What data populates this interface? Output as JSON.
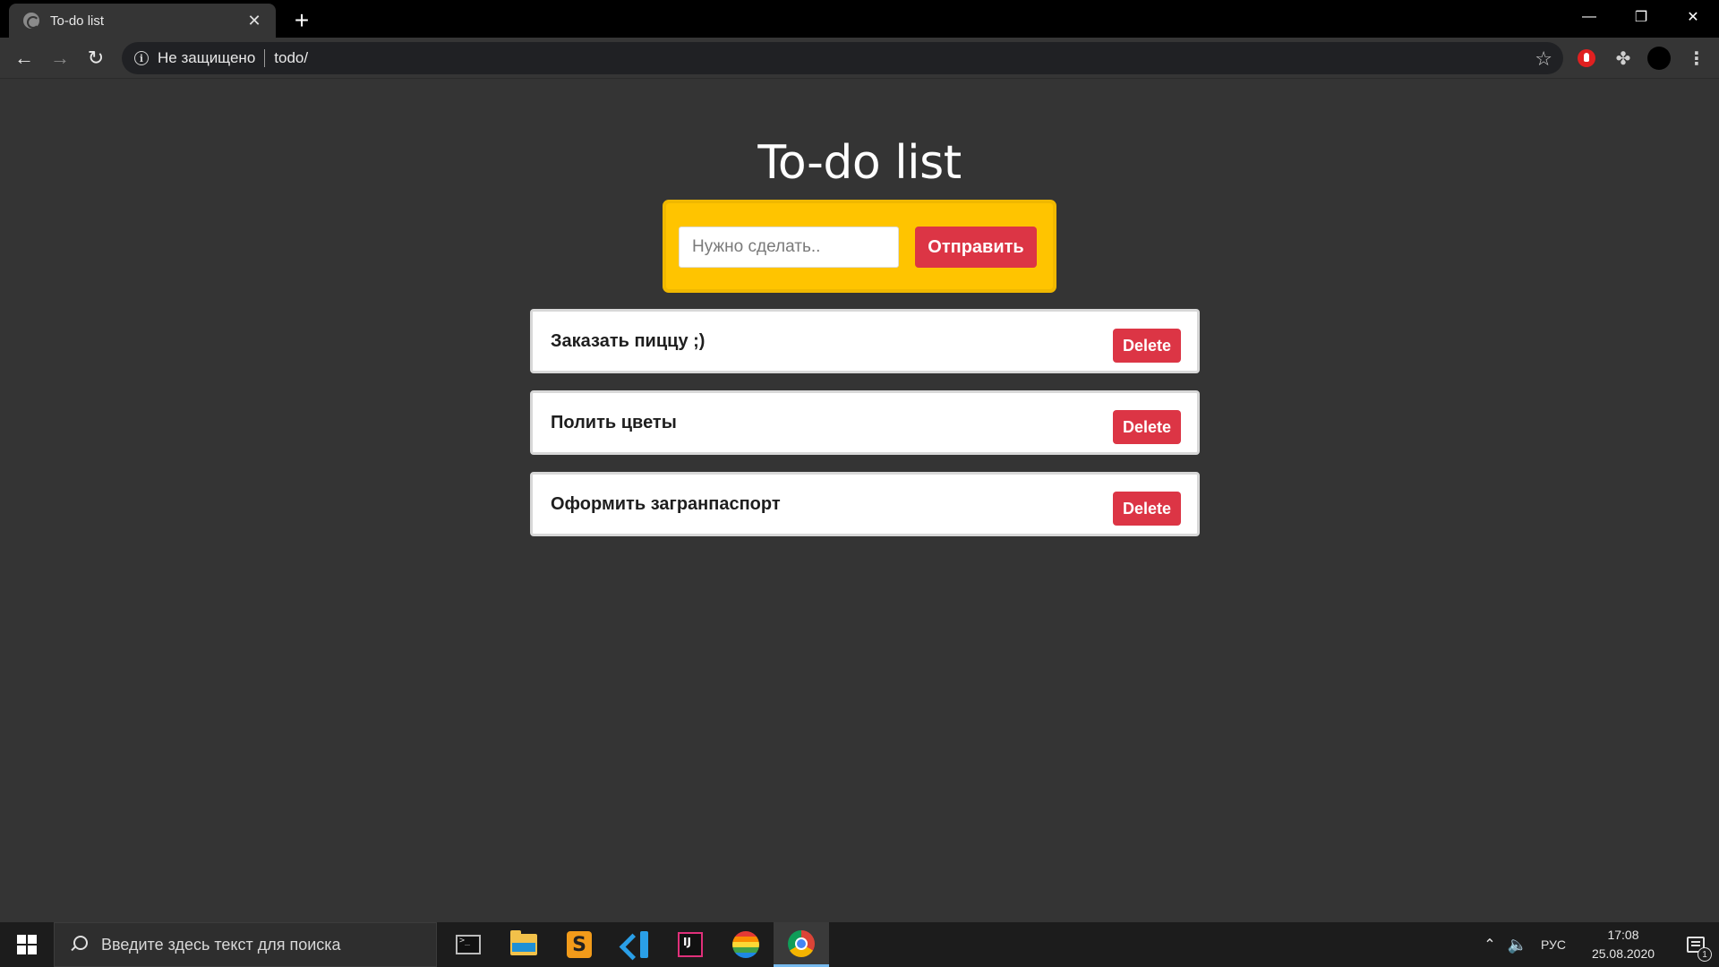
{
  "browser": {
    "tab_title": "To-do list",
    "tab_close": "✕",
    "new_tab": "+",
    "window_controls": {
      "minimize": "—",
      "restore": "❐",
      "close": "✕"
    },
    "nav": {
      "back": "←",
      "forward": "→",
      "reload": "↻"
    },
    "omnibox": {
      "security_label": "Не защищено",
      "url": "todo/"
    },
    "icons": [
      "info-icon",
      "star-icon",
      "adblock-icon",
      "extensions-icon",
      "profile-avatar",
      "menu-icon"
    ]
  },
  "page": {
    "title": "To-do list",
    "form": {
      "input_placeholder": "Нужно сделать..",
      "input_value": "",
      "submit_label": "Отправить"
    },
    "todos": [
      {
        "text": "Заказать пиццу ;)",
        "delete_label": "Delete"
      },
      {
        "text": "Полить цветы",
        "delete_label": "Delete"
      },
      {
        "text": "Оформить загранпаспорт",
        "delete_label": "Delete"
      }
    ]
  },
  "taskbar": {
    "search_placeholder": "Введите здесь текст для поиска",
    "apps": [
      "terminal-icon",
      "file-explorer-icon",
      "sublime-text-icon",
      "vscode-icon",
      "intellij-icon",
      "rainbow-app-icon",
      "chrome-icon"
    ],
    "active_app": "chrome-icon",
    "tray": {
      "language": "РУС",
      "time": "17:08",
      "date": "25.08.2020",
      "notification_count": "1"
    }
  },
  "colors": {
    "page_background": "#343434",
    "form_background": "#ffc400",
    "danger_button": "#dc3545",
    "card_background": "#ffffff"
  }
}
